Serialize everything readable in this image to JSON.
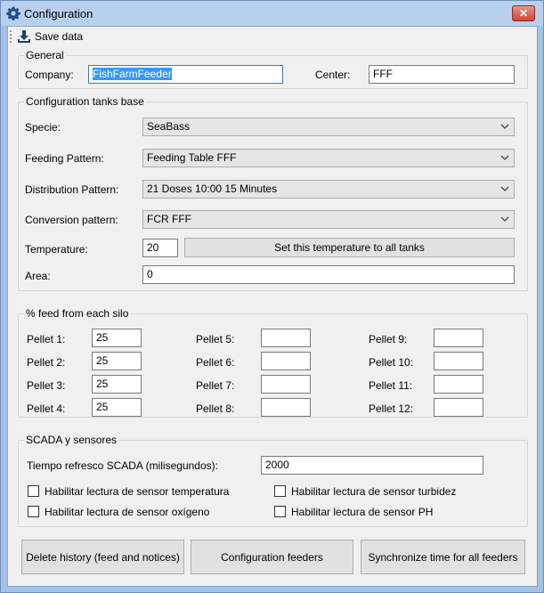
{
  "window": {
    "title": "Configuration",
    "close_label": "✕"
  },
  "toolbar": {
    "save_label": "Save data"
  },
  "general": {
    "title": "General",
    "company_label": "Company:",
    "company_value": "FishFarmFeeder",
    "center_label": "Center:",
    "center_value": "FFF"
  },
  "tanks": {
    "title": "Configuration tanks base",
    "specie_label": "Specie:",
    "specie_value": "SeaBass",
    "feeding_label": "Feeding Pattern:",
    "feeding_value": "Feeding Table FFF",
    "distribution_label": "Distribution Pattern:",
    "distribution_value": "21 Doses 10:00 15 Minutes",
    "conversion_label": "Conversion pattern:",
    "conversion_value": "FCR FFF",
    "temperature_label": "Temperature:",
    "temperature_value": "20",
    "set_temp_button": "Set this temperature to all tanks",
    "area_label": "Area:",
    "area_value": "0"
  },
  "silo": {
    "title": "% feed from each silo",
    "pellets": [
      {
        "label": "Pellet 1:",
        "value": "25"
      },
      {
        "label": "Pellet 2:",
        "value": "25"
      },
      {
        "label": "Pellet 3:",
        "value": "25"
      },
      {
        "label": "Pellet 4:",
        "value": "25"
      },
      {
        "label": "Pellet 5:",
        "value": ""
      },
      {
        "label": "Pellet 6:",
        "value": ""
      },
      {
        "label": "Pellet 7:",
        "value": ""
      },
      {
        "label": "Pellet 8:",
        "value": ""
      },
      {
        "label": "Pellet 9:",
        "value": ""
      },
      {
        "label": "Pellet 10:",
        "value": ""
      },
      {
        "label": "Pellet 11:",
        "value": ""
      },
      {
        "label": "Pellet 12:",
        "value": ""
      }
    ]
  },
  "scada": {
    "title": "SCADA y sensores",
    "refresh_label": "Tiempo refresco SCADA (milisegundos):",
    "refresh_value": "2000",
    "checks": [
      {
        "label": "Habilitar lectura de sensor temperatura",
        "checked": false
      },
      {
        "label": "Habilitar lectura de sensor turbidez",
        "checked": false
      },
      {
        "label": "Habilitar lectura de sensor oxígeno",
        "checked": false
      },
      {
        "label": "Habilitar lectura de sensor PH",
        "checked": false
      }
    ]
  },
  "footer": {
    "delete_button": "Delete history (feed and notices)",
    "feeders_button": "Configuration feeders",
    "sync_button": "Synchronize time for all feeders"
  }
}
